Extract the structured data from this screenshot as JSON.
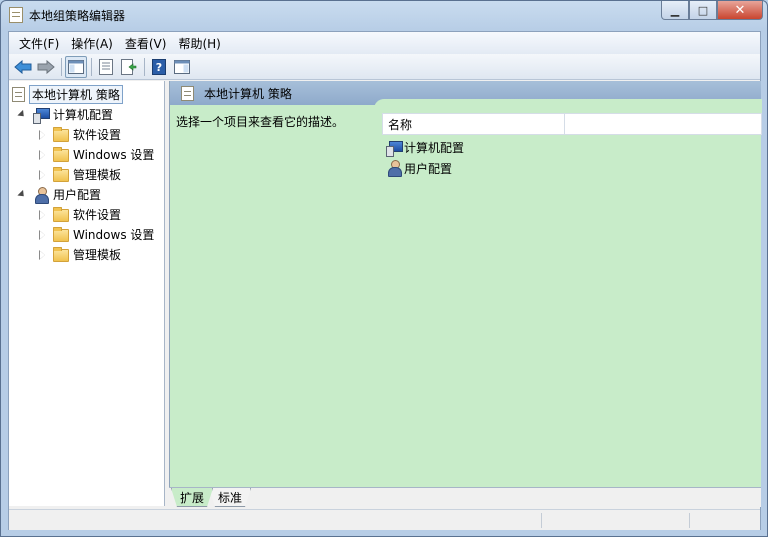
{
  "window": {
    "title": "本地组策略编辑器",
    "minimize_glyph": "▁",
    "maximize_glyph": "□",
    "close_glyph": "✕"
  },
  "menu": [
    "文件(F)",
    "操作(A)",
    "查看(V)",
    "帮助(H)"
  ],
  "toolbar": {
    "buttons": [
      "back-icon",
      "forward-icon",
      "show-hide-tree-icon",
      "properties-icon",
      "export-list-icon",
      "help-icon",
      "show-action-pane-icon"
    ]
  },
  "tree": {
    "root": "本地计算机 策略",
    "computer": {
      "label": "计算机配置",
      "children": [
        "软件设置",
        "Windows 设置",
        "管理模板"
      ]
    },
    "user": {
      "label": "用户配置",
      "children": [
        "软件设置",
        "Windows 设置",
        "管理模板"
      ]
    }
  },
  "details": {
    "title": "本地计算机 策略",
    "description": "选择一个项目来查看它的描述。",
    "column_name": "名称",
    "rows": [
      "计算机配置",
      "用户配置"
    ]
  },
  "tabs": [
    "扩展",
    "标准"
  ],
  "colors": {
    "details_background": "#c8ecc9",
    "header_background": "#8eaacb"
  }
}
